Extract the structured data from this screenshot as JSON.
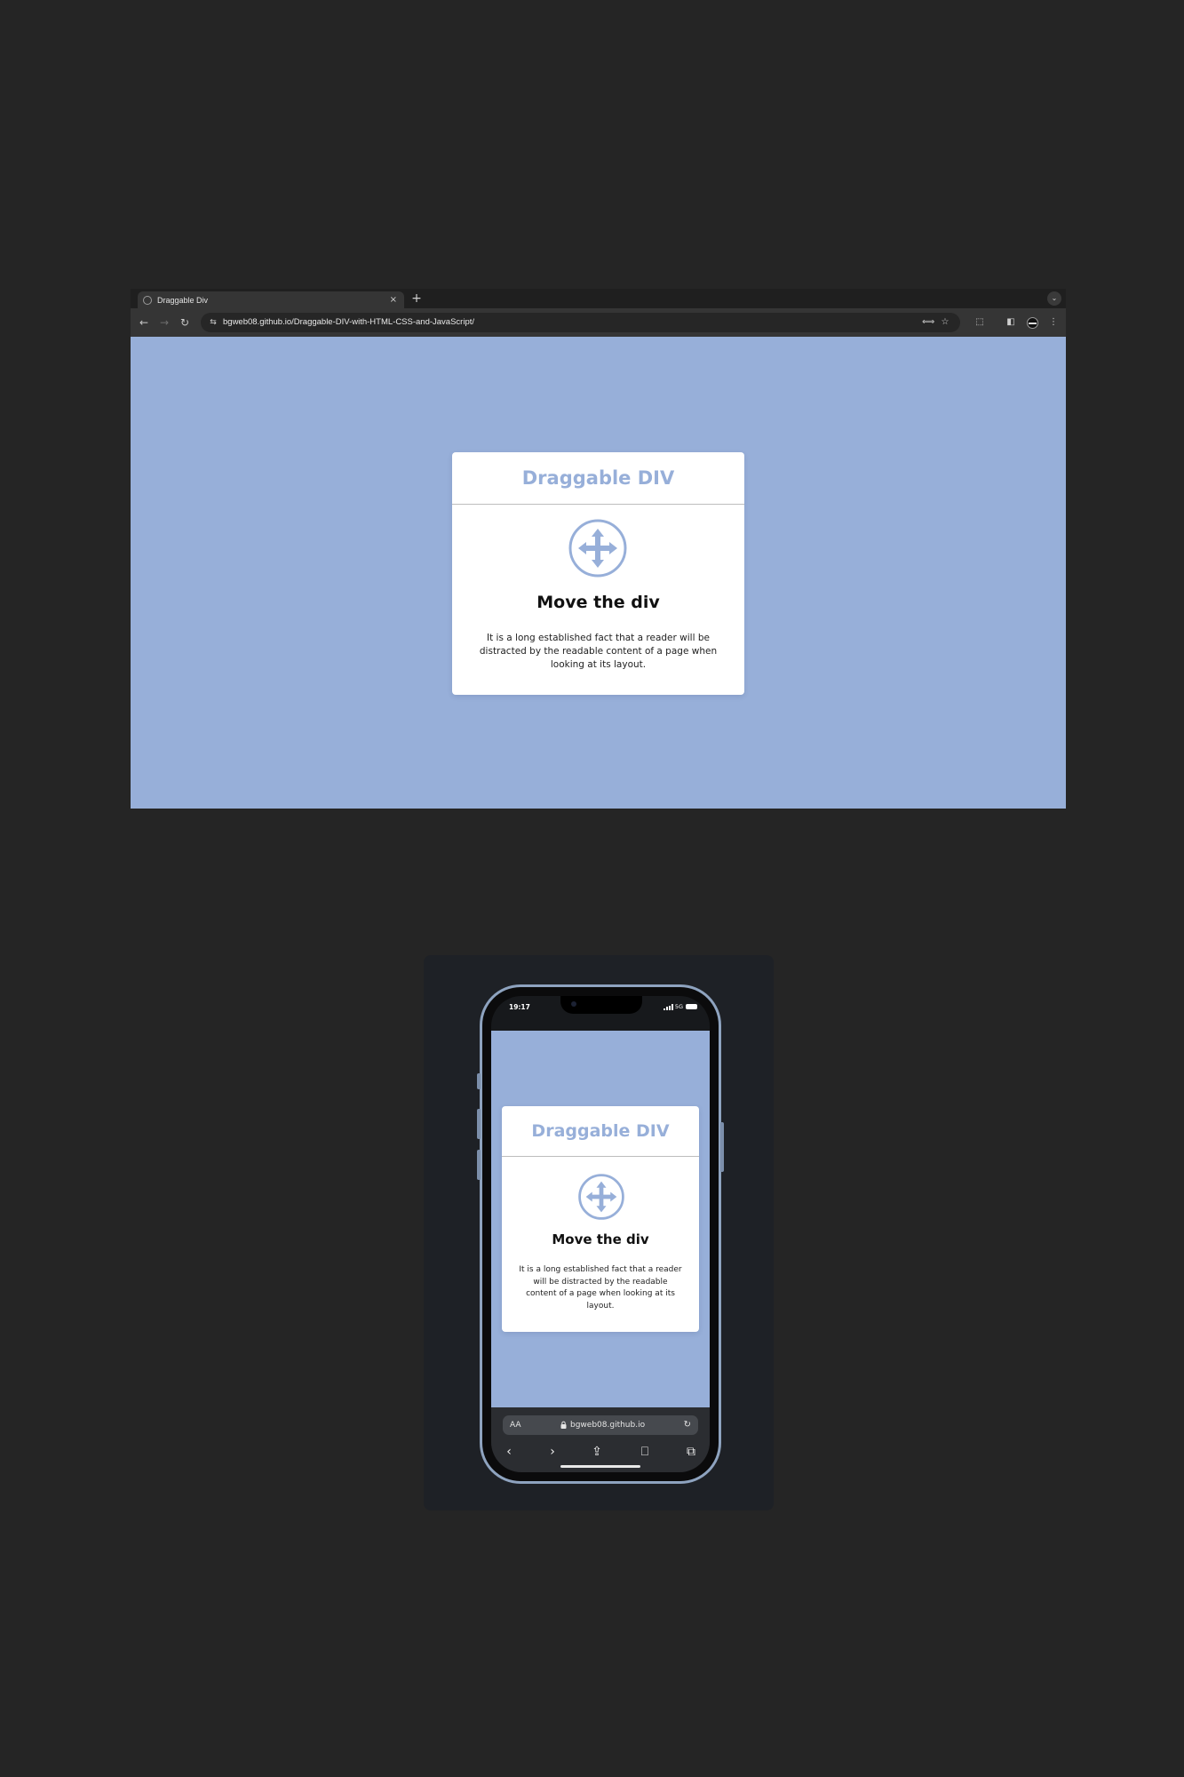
{
  "desktop": {
    "tab": {
      "title": "Draggable Div",
      "close": "×",
      "new_tab": "+"
    },
    "tab_search": "⌄",
    "toolbar": {
      "back": "←",
      "forward": "→",
      "reload": "↻",
      "site_info": "⇆",
      "url": "bgweb08.github.io/Draggable-DIV-with-HTML-CSS-and-JavaScript/",
      "translate": "⟺",
      "bookmark": "☆",
      "extensions": "⬚",
      "side_panel": "◧",
      "menu": "⋮"
    }
  },
  "card": {
    "title": "Draggable DIV",
    "heading": "Move the div",
    "text": "It is a long established fact that a reader will be distracted by the readable content of a page when looking at its layout."
  },
  "mobile": {
    "status": {
      "time": "19:17",
      "network": "5G"
    },
    "safari": {
      "text_size": "AA",
      "url": "bgweb08.github.io",
      "reload": "↻",
      "back": "‹",
      "forward": "›",
      "share": "⇪",
      "bookmarks": "⎕",
      "tabs": "⧉"
    }
  },
  "colors": {
    "accent": "#97afd9",
    "page_background": "#252525"
  }
}
